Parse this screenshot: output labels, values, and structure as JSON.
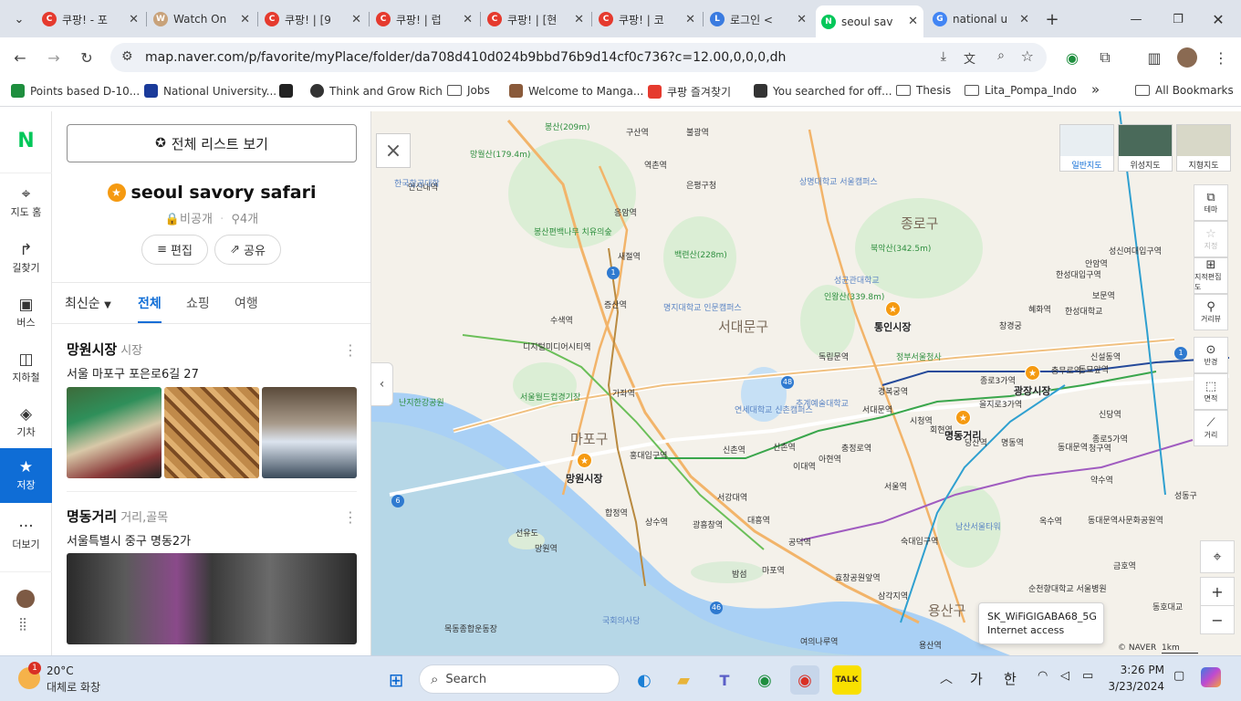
{
  "browser": {
    "tabs": [
      {
        "title": "쿠팡! - 포",
        "icon": "coupang-icon",
        "color": "#e53a2e",
        "letter": "C"
      },
      {
        "title": "Watch On",
        "icon": "watch-icon",
        "color": "#c8a27a",
        "letter": "W"
      },
      {
        "title": "쿠팡! | [9",
        "icon": "coupang-icon",
        "color": "#e53a2e",
        "letter": "C"
      },
      {
        "title": "쿠팡! | 럽",
        "icon": "coupang-icon",
        "color": "#e53a2e",
        "letter": "C"
      },
      {
        "title": "쿠팡! | [현",
        "icon": "coupang-icon",
        "color": "#e53a2e",
        "letter": "C"
      },
      {
        "title": "쿠팡! | 코",
        "icon": "coupang-icon",
        "color": "#e53a2e",
        "letter": "C"
      },
      {
        "title": "로그인 <",
        "icon": "login-icon",
        "color": "#3a7be0",
        "letter": "L"
      },
      {
        "title": "seoul sav",
        "icon": "naver-map-icon",
        "color": "#03c75a",
        "letter": "N"
      },
      {
        "title": "national u",
        "icon": "google-icon",
        "color": "#4285f4",
        "letter": "G"
      }
    ],
    "url": "map.naver.com/p/favorite/myPlace/folder/da708d410d024b9bbd76b9d14cf0c736?c=12.00,0,0,0,dh",
    "bookmarks": [
      {
        "label": "Points based D-10...",
        "icon": "bookmark-icon"
      },
      {
        "label": "National University...",
        "icon": "bookmark-icon"
      },
      {
        "label": "",
        "icon": "bookmark-icon"
      },
      {
        "label": "Think and Grow Rich",
        "icon": "globe-icon"
      },
      {
        "label": "Jobs",
        "icon": "folder-icon"
      },
      {
        "label": "Welcome to Manga...",
        "icon": "bookmark-icon"
      },
      {
        "label": "쿠팡 즐겨찾기",
        "icon": "coupang-icon"
      },
      {
        "label": "You searched for off...",
        "icon": "bookmark-icon"
      },
      {
        "label": "Thesis",
        "icon": "folder-icon"
      },
      {
        "label": "Lita_Pompa_Indo",
        "icon": "folder-icon"
      }
    ],
    "more_bookmarks": "»",
    "all_bookmarks": "All Bookmarks"
  },
  "rail": {
    "logo": "N",
    "items": [
      {
        "label": "지도 홈",
        "icon": "map-pin-icon",
        "glyph": "⌖"
      },
      {
        "label": "길찾기",
        "icon": "directions-icon",
        "glyph": "↱"
      },
      {
        "label": "버스",
        "icon": "bus-icon",
        "glyph": "▣"
      },
      {
        "label": "지하철",
        "icon": "subway-icon",
        "glyph": "◫"
      },
      {
        "label": "기차",
        "icon": "train-icon",
        "glyph": "◈"
      },
      {
        "label": "저장",
        "icon": "star-icon",
        "glyph": "★"
      },
      {
        "label": "더보기",
        "icon": "more-icon",
        "glyph": "···"
      }
    ]
  },
  "panel": {
    "list_button": "전체 리스트 보기",
    "folder_title": "seoul savory safari",
    "visibility": "비공개",
    "count": "4개",
    "edit": "편집",
    "share": "공유",
    "sort": "최신순",
    "filters": [
      "전체",
      "쇼핑",
      "여행"
    ],
    "places": [
      {
        "name": "망원시장",
        "category": "시장",
        "address": "서울 마포구 포은로6길 27"
      },
      {
        "name": "명동거리",
        "category": "거리,골목",
        "address": "서울특별시 중구 명동2가"
      }
    ]
  },
  "map": {
    "close": "×",
    "collapse": "‹",
    "map_types": [
      "일반지도",
      "위성지도",
      "지형지도"
    ],
    "tools": [
      "테마",
      "지정",
      "지적편집도",
      "거리뷰",
      "반경",
      "면적",
      "거리"
    ],
    "zoom_in": "+",
    "zoom_out": "−",
    "copyright": "© NAVER",
    "scale": "1km",
    "districts": [
      "종로구",
      "마포구",
      "서대문구",
      "용산구"
    ],
    "saved_places": [
      "망원시장",
      "명동거리",
      "광장시장",
      "통인시장"
    ],
    "stations": [
      "디지털미디어시티역",
      "홍대입구역",
      "합정역",
      "서울역",
      "시청역",
      "종로3가역",
      "을지로3가역",
      "동대문역",
      "신당역",
      "충정로역",
      "이대역",
      "신촌역",
      "아현역",
      "공덕역",
      "마포역",
      "효창공원앞역",
      "삼각지역",
      "숙대입구역",
      "회현역",
      "명동역",
      "약수역",
      "청구역",
      "동묘앞역",
      "보문역",
      "한성대입구역",
      "성신여대입구역",
      "신설동역",
      "안암역",
      "증산역",
      "수색역",
      "가좌역",
      "연신내역",
      "구산역",
      "역촌역",
      "불광역",
      "응암역",
      "새절역",
      "독립문역",
      "경복궁역",
      "서대문역",
      "광흥창역",
      "상수역",
      "대흥역",
      "서강대역",
      "신촌역",
      "망원역",
      "당산역",
      "충무로역",
      "종로5가역",
      "동대문역사문화공원역",
      "금호역",
      "옥수역",
      "버티고개역"
    ],
    "landmarks": [
      "남산서울타워",
      "연세대학교 신촌캠퍼스",
      "명지대학교 인문캠퍼스",
      "상명대학교 서울캠퍼스",
      "국회의사당",
      "성균관대학교",
      "추계예술대학교",
      "한국항공대학",
      "서울월드컵경기장",
      "난지한강공원",
      "봉산(209m)",
      "망월산(179.4m)",
      "백련산(228m)",
      "북악산(342.5m)",
      "인왕산(339.8m)",
      "봉산편백나무 치유의숲",
      "은평구청",
      "정부서울청사",
      "창경궁",
      "혜화역",
      "한성대학교",
      "밤섬",
      "선유도",
      "여의나루역",
      "목동종합운동장",
      "용산역",
      "순천향대학교 서울병원",
      "동호대교",
      "성동구"
    ],
    "route_badges": [
      "1",
      "6",
      "48",
      "46",
      "1"
    ]
  },
  "wifi_tooltip": {
    "ssid": "SK_WiFiGIGABA68_5G",
    "status": "Internet access"
  },
  "taskbar": {
    "weather_temp": "20°C",
    "weather_desc": "대체로 화창",
    "search": "Search",
    "ime1": "가",
    "ime2": "한",
    "time": "3:26 PM",
    "date": "3/23/2024",
    "notification_badge": "1"
  }
}
